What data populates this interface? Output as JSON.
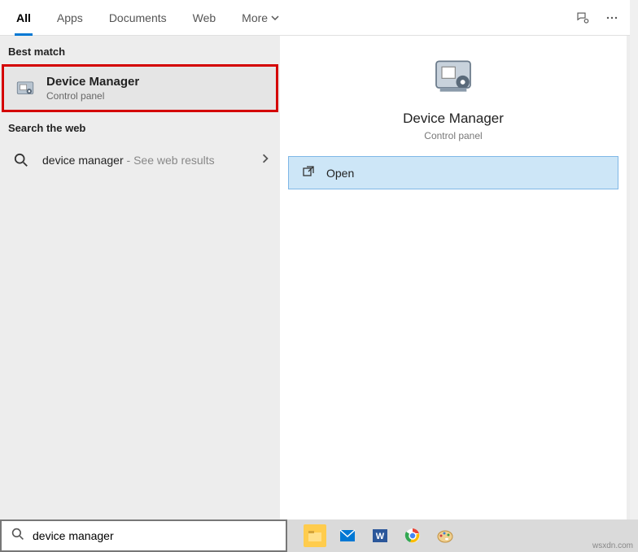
{
  "tabs": {
    "all": "All",
    "apps": "Apps",
    "documents": "Documents",
    "web": "Web",
    "more": "More"
  },
  "sections": {
    "best_match": "Best match",
    "search_web": "Search the web"
  },
  "result": {
    "title": "Device Manager",
    "subtitle": "Control panel"
  },
  "web_result": {
    "query": "device manager",
    "suffix": " - See web results"
  },
  "preview": {
    "title": "Device Manager",
    "subtitle": "Control panel"
  },
  "action": {
    "open": "Open"
  },
  "searchbox": {
    "value": "device manager"
  },
  "watermark": "wsxdn.com"
}
